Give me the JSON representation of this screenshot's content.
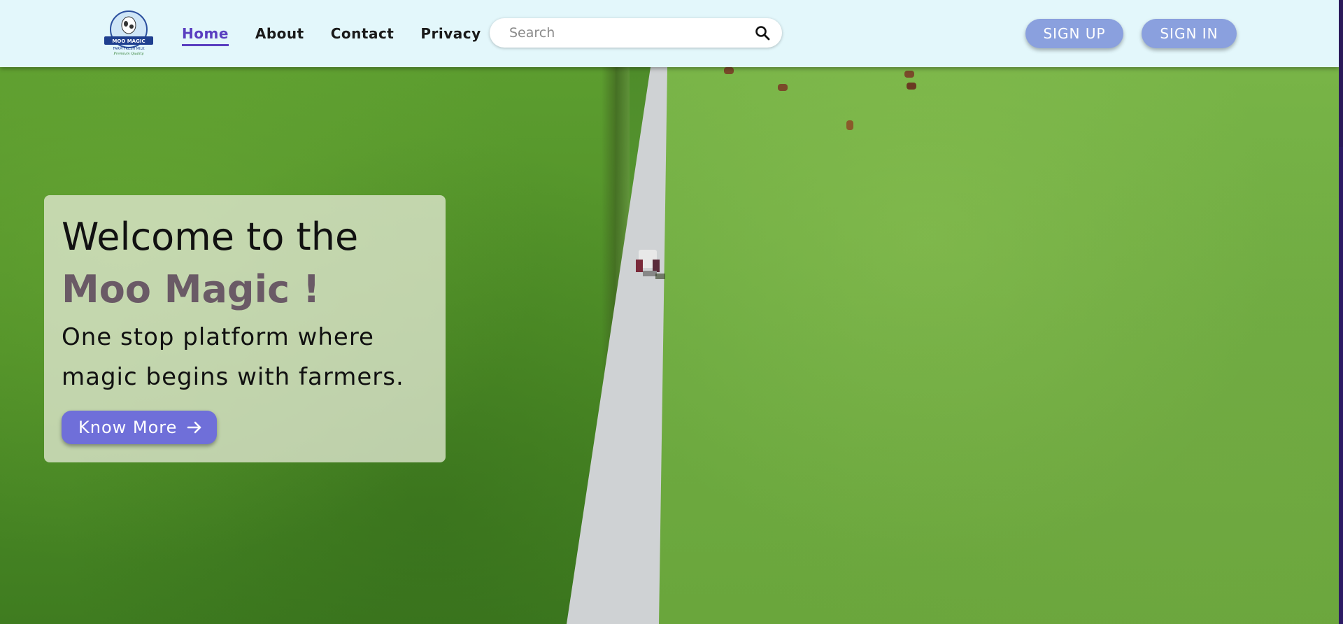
{
  "header": {
    "logo": {
      "icon": "cow-logo-icon",
      "brand_text": "MOO MAGIC",
      "tagline": "FARM FRESH MILK",
      "sub_tagline": "Premium Quality"
    },
    "nav": [
      {
        "label": "Home",
        "active": true
      },
      {
        "label": "About",
        "active": false
      },
      {
        "label": "Contact",
        "active": false
      },
      {
        "label": "Privacy",
        "active": false
      }
    ],
    "search": {
      "placeholder": "Search",
      "value": "",
      "icon": "search-icon"
    },
    "signup_label": "SIGN UP",
    "signin_label": "SIGN IN"
  },
  "hero": {
    "title_line1": "Welcome to the",
    "title_line2": "Moo Magic !",
    "subtitle": "One stop platform where magic begins with farmers.",
    "cta_label": "Know More",
    "cta_icon": "arrow-right-icon"
  },
  "colors": {
    "header_bg": "#e3f7fb",
    "accent": "#5a3fc0",
    "auth_button": "#8aa0de",
    "cta_button": "#6f6fd9",
    "brand_title": "#6a5a66"
  }
}
